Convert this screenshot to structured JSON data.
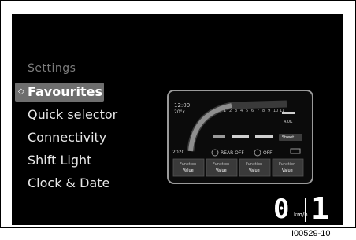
{
  "menu": {
    "title": "Settings",
    "items": [
      {
        "label": "Favourites",
        "selected": true
      },
      {
        "label": "Quick selector",
        "selected": false
      },
      {
        "label": "Connectivity",
        "selected": false
      },
      {
        "label": "Shift Light",
        "selected": false
      },
      {
        "label": "Clock & Date",
        "selected": false
      }
    ],
    "selected_marker": "◇"
  },
  "preview": {
    "time": "12:00",
    "temp": "20°c",
    "odometer": "2020",
    "rpm_scale": [
      "1",
      "2",
      "3",
      "4",
      "5",
      "6",
      "7",
      "8",
      "9",
      "10",
      "11"
    ],
    "rear_label": "REAR OFF",
    "off_label": "OFF",
    "mode_label": "Street",
    "small_value": "4.0K",
    "function_tiles": [
      {
        "title": "Function",
        "value": "Value"
      },
      {
        "title": "Function",
        "value": "Value"
      },
      {
        "title": "Function",
        "value": "Value"
      },
      {
        "title": "Function",
        "value": "Value"
      }
    ]
  },
  "status": {
    "speed": "0",
    "speed_unit": "km/h",
    "gear": "1"
  },
  "reference_code": "I00529-10",
  "colors": {
    "screen_bg": "#000000",
    "selection_bg": "#6e6e6e",
    "text": "#e8e8e8",
    "muted": "#7d7d7d"
  }
}
